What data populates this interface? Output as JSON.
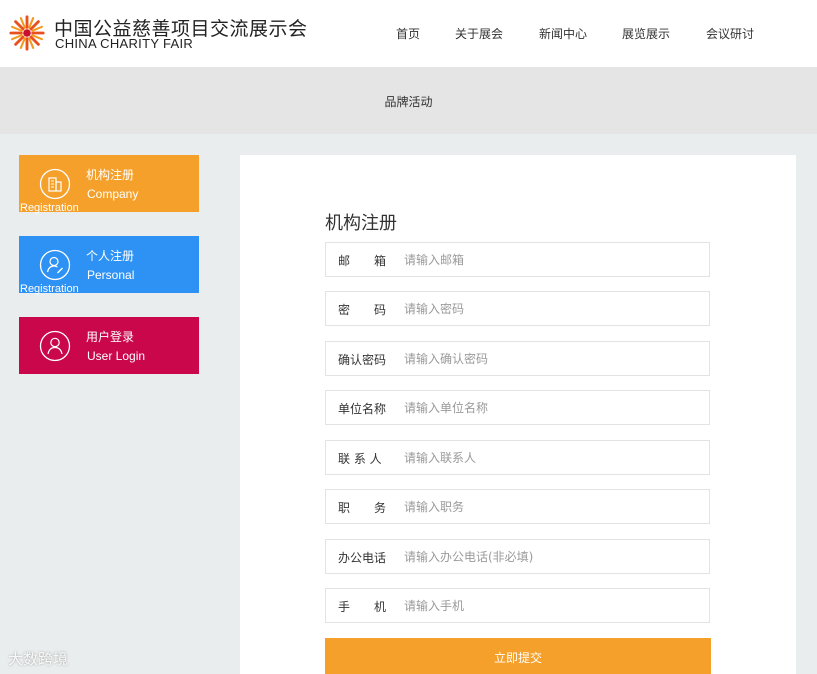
{
  "colors": {
    "accent_orange": "#f5a02a",
    "card_blue": "#2e92f5",
    "card_crimson": "#c9074a",
    "banner_gray": "#e5e5e5",
    "content_bg": "#eaeded"
  },
  "header": {
    "logo_cn": "中国公益慈善项目交流展示会",
    "logo_en": "CHINA CHARITY FAIR",
    "nav": [
      "首页",
      "关于展会",
      "新闻中心",
      "展览展示",
      "会议研讨"
    ]
  },
  "banner": {
    "title": "品牌活动"
  },
  "sidebar": {
    "items": [
      {
        "title": "机构注册",
        "en_1": "Company",
        "en_2": "Registration",
        "icon": "building-icon"
      },
      {
        "title": "个人注册",
        "en_1": "Personal",
        "en_2": "Registration",
        "icon": "person-edit-icon"
      },
      {
        "title": "用户登录",
        "en_1": "User Login",
        "en_2": "",
        "icon": "user-icon"
      }
    ]
  },
  "form": {
    "title": "机构注册",
    "fields": [
      {
        "label": "邮　　箱",
        "placeholder": "请输入邮箱"
      },
      {
        "label": "密　　码",
        "placeholder": "请输入密码"
      },
      {
        "label": "确认密码",
        "placeholder": "请输入确认密码"
      },
      {
        "label": "单位名称",
        "placeholder": "请输入单位名称"
      },
      {
        "label": "联 系 人",
        "placeholder": "请输入联系人"
      },
      {
        "label": "职　　务",
        "placeholder": "请输入职务"
      },
      {
        "label": "办公电话",
        "placeholder": "请输入办公电话(非必填)"
      },
      {
        "label": "手　　机",
        "placeholder": "请输入手机"
      }
    ],
    "submit_label": "立即提交"
  },
  "watermark": "大数跨境"
}
